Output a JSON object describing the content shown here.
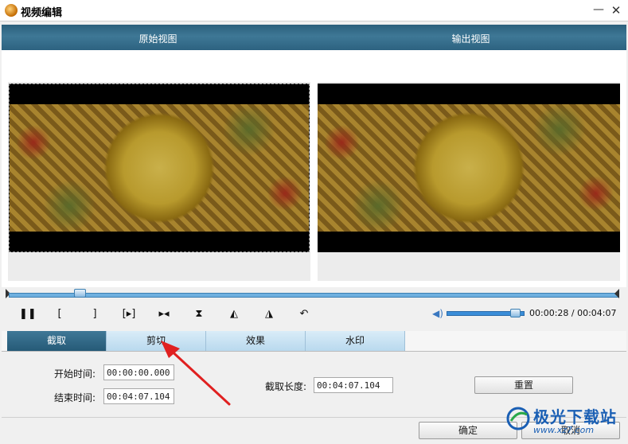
{
  "window": {
    "title": "视频编辑",
    "minimize_glyph": "—",
    "close_glyph": "✕"
  },
  "views": {
    "original_label": "原始视图",
    "output_label": "输出视图"
  },
  "playback": {
    "position_fraction": 0.116,
    "controls": [
      {
        "name": "pause-icon",
        "glyph": "❚❚"
      },
      {
        "name": "set-start-icon",
        "glyph": "["
      },
      {
        "name": "set-end-icon",
        "glyph": "]"
      },
      {
        "name": "play-segment-icon",
        "glyph": "[▸]"
      },
      {
        "name": "step-icon",
        "glyph": "▸◂"
      },
      {
        "name": "flip-vertical-icon",
        "glyph": "⧗"
      },
      {
        "name": "rotate-left-icon",
        "glyph": "◭"
      },
      {
        "name": "rotate-right-icon",
        "glyph": "◮"
      },
      {
        "name": "undo-icon",
        "glyph": "↶"
      }
    ],
    "volume_fraction": 0.9,
    "time_display": "00:00:28 / 00:04:07"
  },
  "tabs": [
    {
      "label": "截取",
      "active": true
    },
    {
      "label": "剪切",
      "active": false
    },
    {
      "label": "效果",
      "active": false
    },
    {
      "label": "水印",
      "active": false
    }
  ],
  "trim": {
    "start_label": "开始时间:",
    "start_value": "00:00:00.000",
    "end_label": "结束时间:",
    "end_value": "00:04:07.104",
    "length_label": "截取长度:",
    "length_value": "00:04:07.104",
    "reset_label": "重置"
  },
  "footer": {
    "ok_label": "确定",
    "cancel_label": "取消"
  },
  "watermark": {
    "brand": "极光下载站",
    "url": "www.xz7.com"
  },
  "colors": {
    "header_bar": "#3e7896",
    "active_tab": "#2f6888",
    "inactive_tab": "#c6e2f4",
    "annotation_arrow": "#e02020"
  }
}
